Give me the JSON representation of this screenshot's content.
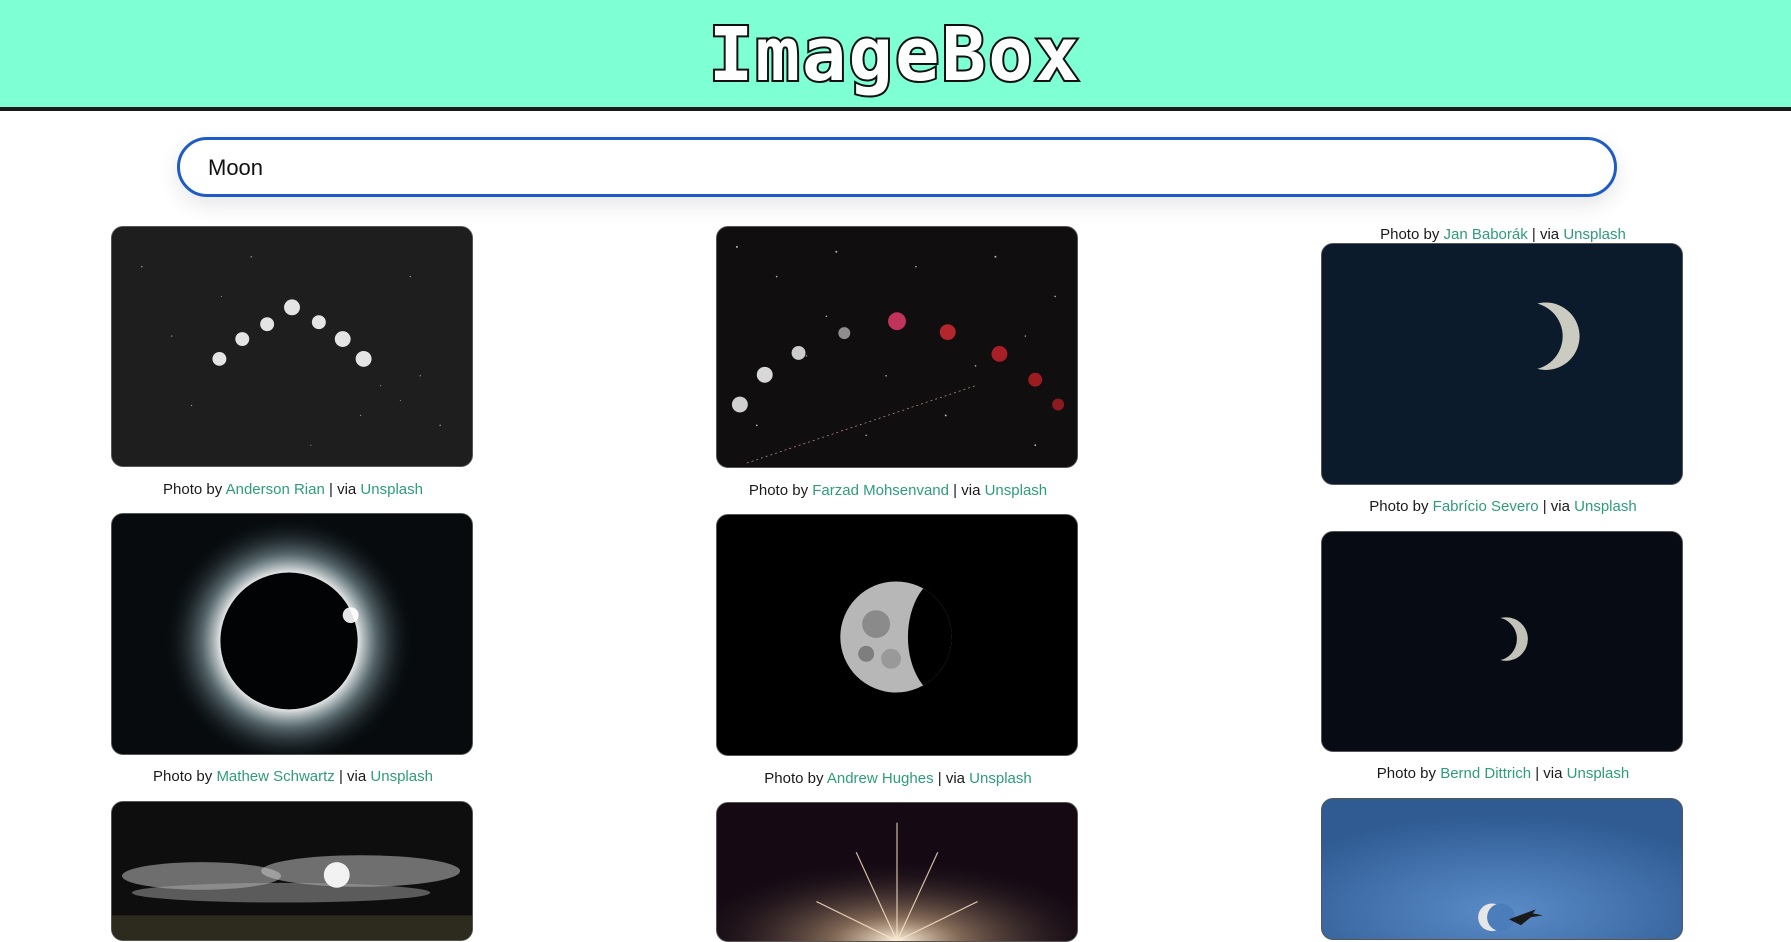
{
  "app": {
    "title": "ImageBox"
  },
  "search": {
    "value": "Moon",
    "placeholder": ""
  },
  "colors": {
    "header_bg": "#7fffd4",
    "link": "#2e9c7a",
    "search_border": "#1e5bc6"
  },
  "photos": [
    {
      "label": "Photo by",
      "author": "Anderson Rian",
      "via": "| via",
      "source": "Unsplash"
    },
    {
      "label": "Photo by",
      "author": "Farzad Mohsenvand",
      "via": "| via",
      "source": "Unsplash"
    },
    {
      "label": "Photo by",
      "author": "Jan Baborák",
      "via": "| via",
      "source": "Unsplash"
    },
    {
      "label": "Photo by",
      "author": "Mathew Schwartz",
      "via": "| via",
      "source": "Unsplash"
    },
    {
      "label": "Photo by",
      "author": "Andrew Hughes",
      "via": "| via",
      "source": "Unsplash"
    },
    {
      "label": "Photo by",
      "author": "Fabrício Severo",
      "via": "| via",
      "source": "Unsplash"
    },
    {
      "label": "Photo by",
      "author": "Bernd Dittrich",
      "via": "| via",
      "source": "Unsplash"
    }
  ]
}
